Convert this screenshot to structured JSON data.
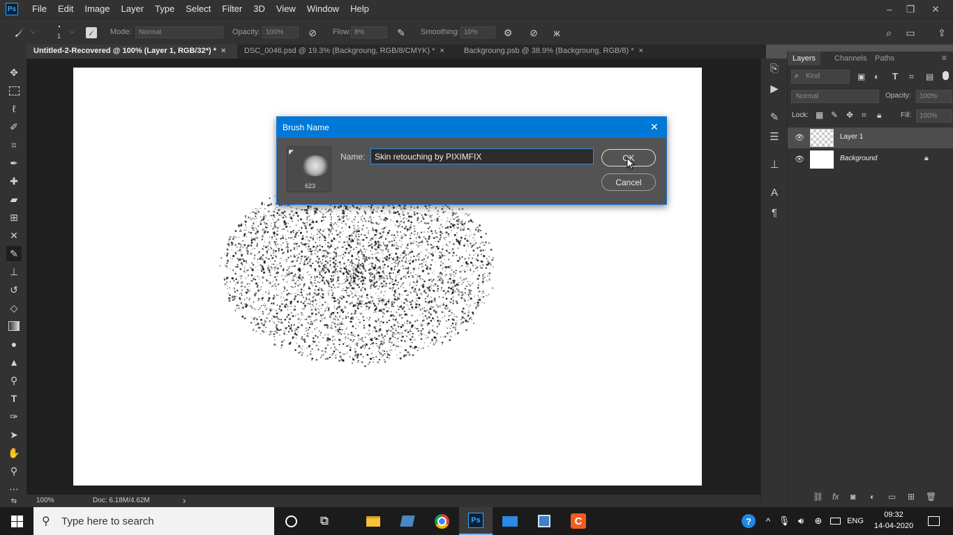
{
  "app": {
    "logo_text": "Ps",
    "accent": "#31a8ff"
  },
  "menu": [
    "File",
    "Edit",
    "Image",
    "Layer",
    "Type",
    "Select",
    "Filter",
    "3D",
    "View",
    "Window",
    "Help"
  ],
  "window_controls": {
    "minimize": "–",
    "restore": "❐",
    "close": "✕"
  },
  "options_bar": {
    "brush_size": "1",
    "mode_label": "Mode:",
    "mode_value": "Normal",
    "opacity_label": "Opacity:",
    "opacity_value": "100%",
    "flow_label": "Flow:",
    "flow_value": "8%",
    "smoothing_label": "Smoothing:",
    "smoothing_value": "10%"
  },
  "tabs": [
    {
      "label": "Untitled-2-Recovered @ 100% (Layer 1, RGB/32*) *",
      "close": "×"
    },
    {
      "label": "DSC_0046.psd @ 19.3% (Backgroung, RGB/8/CMYK) *",
      "close": "×"
    },
    {
      "label": "Backgroung.psb @ 38.9% (Backgroung, RGB/8) *",
      "close": "×"
    }
  ],
  "status_bar": {
    "zoom": "100%",
    "doc": "Doc: 6.18M/4.62M",
    "arrow": "›"
  },
  "layers_panel": {
    "tabs": [
      "Layers",
      "Channels",
      "Paths"
    ],
    "filter_placeholder": "Kind",
    "blend_mode": "Normal",
    "opacity_label": "Opacity:",
    "opacity_value": "100%",
    "lock_label": "Lock:",
    "fill_label": "Fill:",
    "fill_value": "100%",
    "layers": [
      {
        "name": "Layer 1",
        "selected": true
      },
      {
        "name": "Background",
        "selected": false,
        "locked": true
      }
    ],
    "footer_fx": "fx"
  },
  "dialog": {
    "title": "Brush Name",
    "close": "✕",
    "name_label": "Name:",
    "name_value": "Skin retouching by PIXIMFIX",
    "brush_size": "623",
    "ok_label": "OK",
    "cancel_label": "Cancel"
  },
  "taskbar": {
    "search_placeholder": "Type here to search",
    "help_glyph": "?",
    "language": "ENG",
    "time": "09:32",
    "date": "14-04-2020"
  }
}
